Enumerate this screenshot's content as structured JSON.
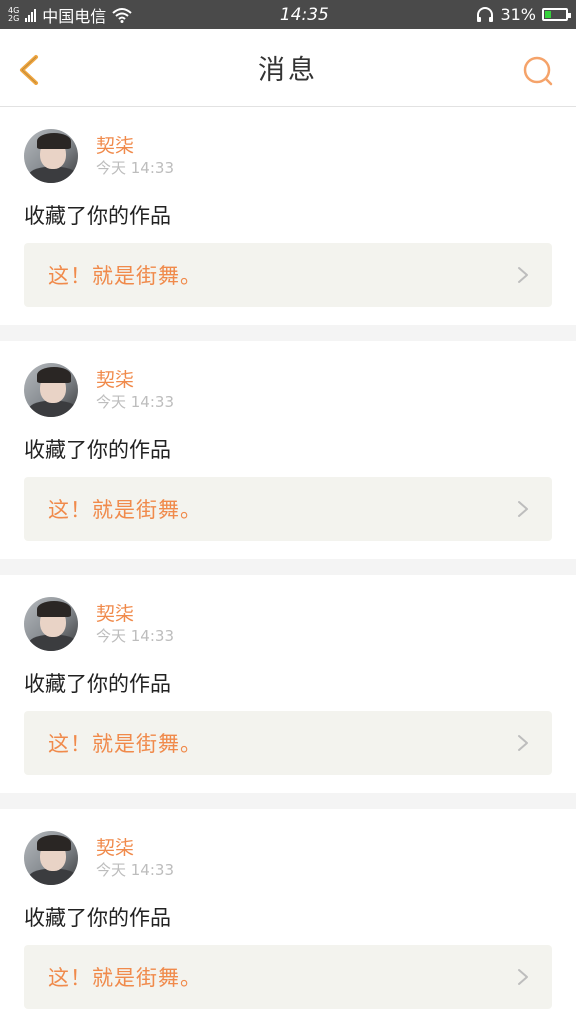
{
  "status_bar": {
    "signal_4g": "4G",
    "signal_2g": "2G",
    "carrier": "中国电信",
    "time": "14:35",
    "battery": "31%",
    "battery_level": 0.31
  },
  "header": {
    "title": "消息"
  },
  "colors": {
    "accent": "#f08a4b",
    "status_bg": "#4a4a4a",
    "battery_green": "#37d23c"
  },
  "messages": [
    {
      "username": "契柒",
      "time": "今天 14:33",
      "action": "收藏了你的作品",
      "work_title": "这！就是街舞。"
    },
    {
      "username": "契柒",
      "time": "今天 14:33",
      "action": "收藏了你的作品",
      "work_title": "这！就是街舞。"
    },
    {
      "username": "契柒",
      "time": "今天 14:33",
      "action": "收藏了你的作品",
      "work_title": "这！就是街舞。"
    },
    {
      "username": "契柒",
      "time": "今天 14:33",
      "action": "收藏了你的作品",
      "work_title": "这！就是街舞。"
    }
  ]
}
